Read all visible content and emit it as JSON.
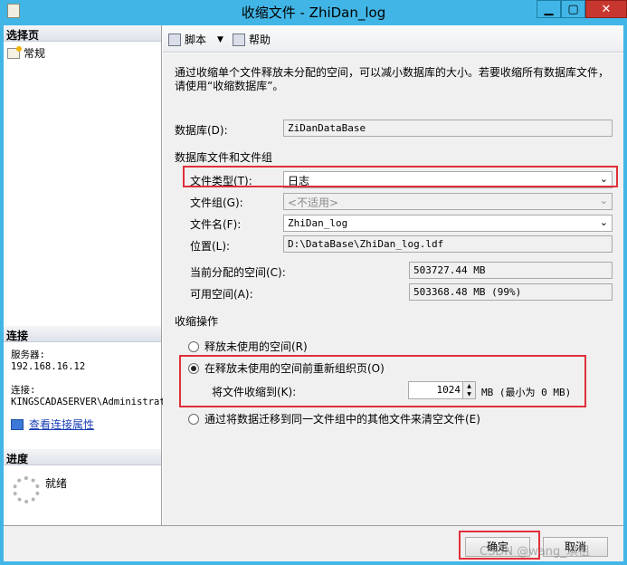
{
  "window": {
    "title": "收缩文件 - ZhiDan_log",
    "minimize": "▁",
    "maximize": "▢",
    "close": "✕"
  },
  "left": {
    "pages_header": "选择页",
    "pages": [
      {
        "label": "常规",
        "icon": "wrench-page-icon"
      }
    ],
    "connection_header": "连接",
    "server_label": "服务器:",
    "server_value": "192.168.16.12",
    "connection_label": "连接:",
    "connection_value": "KINGSCADASERVER\\Administrat",
    "view_connection_props": "查看连接属性",
    "progress_header": "进度",
    "progress_status": "就绪"
  },
  "toolbar": {
    "script_label": "脚本",
    "help_label": "帮助"
  },
  "form": {
    "description": "通过收缩单个文件释放未分配的空间，可以减小数据库的大小。若要收缩所有数据库文件，请使用“收缩数据库”。",
    "database_label": "数据库(D):",
    "database_value": "ZiDanDataBase",
    "files_group_label": "数据库文件和文件组",
    "file_type_label": "文件类型(T):",
    "file_type_value": "日志",
    "filegroup_label": "文件组(G):",
    "filegroup_value": "<不适用>",
    "filename_label": "文件名(F):",
    "filename_value": "ZhiDan_log",
    "location_label": "位置(L):",
    "location_value": "D:\\DataBase\\ZhiDan_log.ldf",
    "allocated_label": "当前分配的空间(C):",
    "allocated_value": "503727.44 MB",
    "available_label": "可用空间(A):",
    "available_value": "503368.48 MB (99%)",
    "shrink_action_label": "收缩操作",
    "option_release": "释放未使用的空间(R)",
    "option_reorganize": "在释放未使用的空间前重新组织页(O)",
    "shrink_to_label": "将文件收缩到(K):",
    "shrink_to_value": "1024",
    "shrink_to_unit": "MB (最小为 0 MB)",
    "option_empty": "通过将数据迁移到同一文件组中的其他文件来清空文件(E)",
    "selected_option": "reorganize"
  },
  "buttons": {
    "ok": "确定",
    "cancel": "取消"
  },
  "watermark": "CSDN @wang_琪祖",
  "colors": {
    "titlebar": "#41b6e6",
    "highlight": "#e0303a",
    "panel": "#f0f0f0"
  }
}
